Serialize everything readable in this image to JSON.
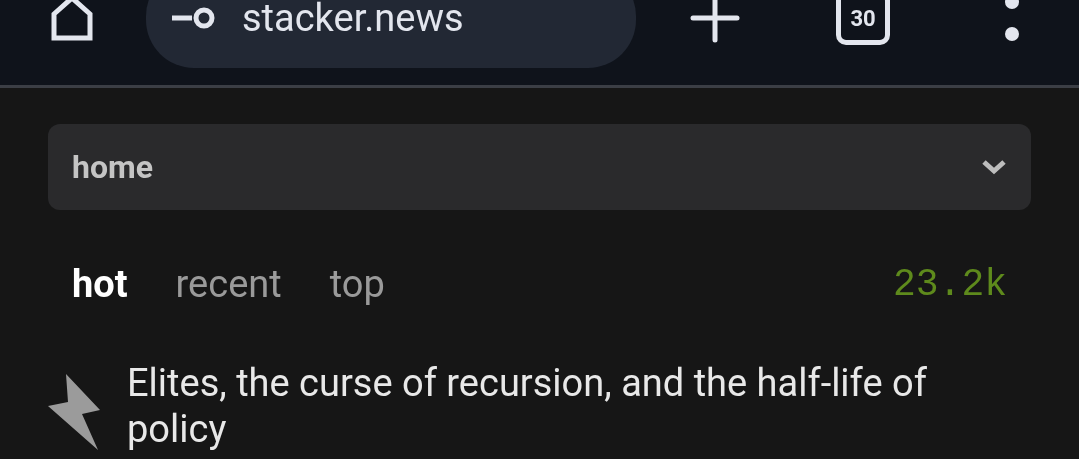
{
  "browser": {
    "url": "stacker.news",
    "tab_count": "30"
  },
  "territory_select": {
    "value": "home"
  },
  "sorts": [
    {
      "label": "hot",
      "selected": true
    },
    {
      "label": "recent",
      "selected": false
    },
    {
      "label": "top",
      "selected": false
    }
  ],
  "wallet_balance": "23.2k",
  "items": [
    {
      "title": "Elites, the curse of recursion, and the half-life of policy"
    }
  ]
}
